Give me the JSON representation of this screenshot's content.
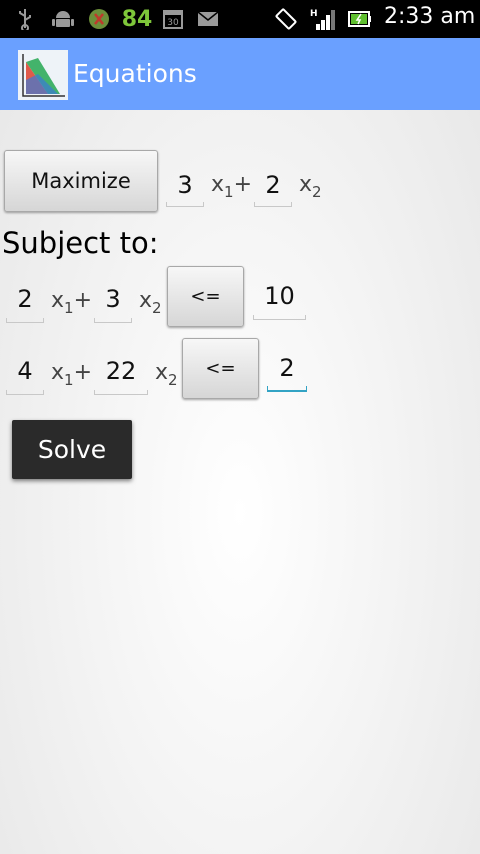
{
  "status_bar": {
    "notification_count": "84",
    "time": "2:33 am",
    "signal_label": "H",
    "icons": [
      "usb-icon",
      "android-icon",
      "battery-app-icon",
      "calendar-icon",
      "mail-icon",
      "rotate-icon",
      "signal-icon",
      "battery-icon"
    ]
  },
  "action_bar": {
    "title": "Equations"
  },
  "objective": {
    "mode_label": "Maximize",
    "c1": "3",
    "c2": "2",
    "x1_label": "x",
    "x1_sub": "1",
    "plus": "+",
    "x2_label": "x",
    "x2_sub": "2"
  },
  "subject_to_label": "Subject to:",
  "constraints": [
    {
      "a1": "2",
      "a2": "3",
      "op": "<=",
      "rhs": "10"
    },
    {
      "a1": "4",
      "a2": "22",
      "op": "<=",
      "rhs": "2"
    }
  ],
  "solve_label": "Solve",
  "colors": {
    "action_bar": "#6aa0ff",
    "accent": "#33a3c4",
    "count": "#7ec63a"
  }
}
